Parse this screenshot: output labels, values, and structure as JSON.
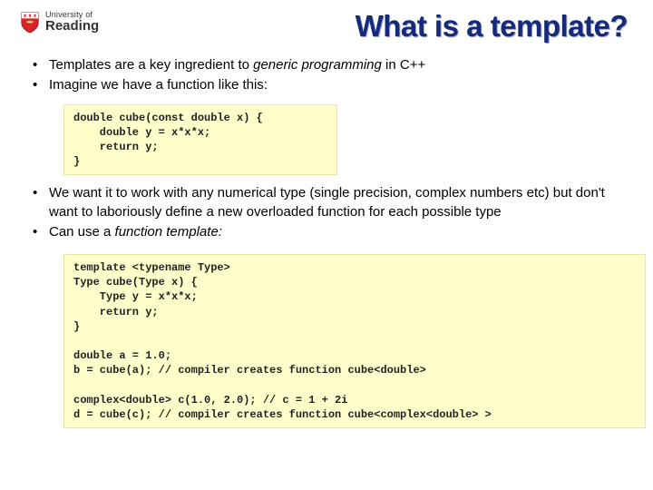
{
  "logo": {
    "small": "University of",
    "big": "Reading"
  },
  "title": "What is a template?",
  "bullets": {
    "b1_a": "Templates are a key ingredient to ",
    "b1_i": "generic programming",
    "b1_b": " in C++",
    "b2": "Imagine we have a function like this:",
    "b3": "We want it to work with any numerical type (single precision, complex numbers etc) but don't want to laboriously define a new overloaded function for each possible type",
    "b4_a": "Can use a ",
    "b4_i": "function template:"
  },
  "code1": "double cube(const double x) {\n    double y = x*x*x;\n    return y;\n}",
  "code2": "template <typename Type>\nType cube(Type x) {\n    Type y = x*x*x;\n    return y;\n}\n\ndouble a = 1.0;\nb = cube(a); // compiler creates function cube<double>\n\ncomplex<double> c(1.0, 2.0); // c = 1 + 2i\nd = cube(c); // compiler creates function cube<complex<double> >",
  "chart_data": {
    "type": "table",
    "note": "No quantitative chart; slide content only."
  }
}
